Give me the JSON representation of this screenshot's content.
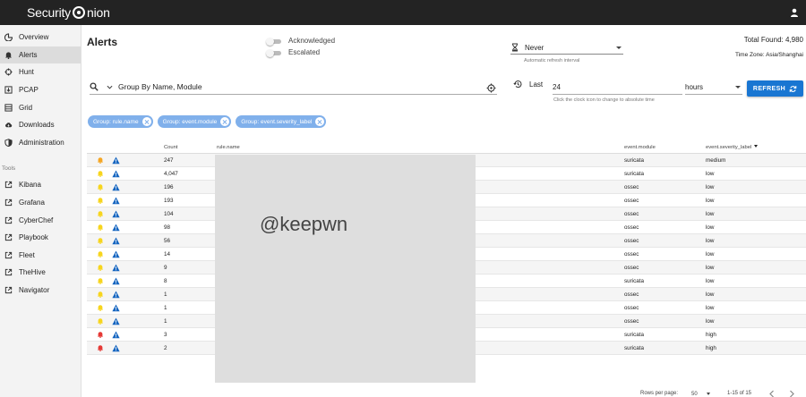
{
  "app": {
    "brand_prefix": "Security ",
    "brand_suffix": "nion"
  },
  "sidebar": {
    "items": [
      {
        "label": "Overview",
        "icon": "dashboard-icon"
      },
      {
        "label": "Alerts",
        "icon": "bell-icon",
        "active": true
      },
      {
        "label": "Hunt",
        "icon": "crosshair-icon"
      },
      {
        "label": "PCAP",
        "icon": "download-box-icon"
      },
      {
        "label": "Grid",
        "icon": "grid-icon"
      },
      {
        "label": "Downloads",
        "icon": "cloud-download-icon"
      },
      {
        "label": "Administration",
        "icon": "shield-icon"
      }
    ],
    "tools_label": "Tools",
    "tools": [
      {
        "label": "Kibana",
        "icon": "external-link-icon"
      },
      {
        "label": "Grafana",
        "icon": "external-link-icon"
      },
      {
        "label": "CyberChef",
        "icon": "external-link-icon"
      },
      {
        "label": "Playbook",
        "icon": "external-link-icon"
      },
      {
        "label": "Fleet",
        "icon": "external-link-icon"
      },
      {
        "label": "TheHive",
        "icon": "external-link-icon"
      },
      {
        "label": "Navigator",
        "icon": "external-link-icon"
      }
    ]
  },
  "header": {
    "title": "Alerts",
    "acknowledged_label": "Acknowledged",
    "escalated_label": "Escalated",
    "refresh_value": "Never",
    "refresh_hint": "Automatic refresh interval",
    "total_found": "Total Found: 4,980",
    "timezone": "Time Zone: Asia/Shanghai"
  },
  "query": {
    "group_by": "Group By Name, Module",
    "last_label": "Last",
    "last_value": "24",
    "unit": "hours",
    "time_hint": "Click the clock icon to change to absolute time",
    "refresh_button": "REFRESH"
  },
  "chips": [
    "Group: rule.name",
    "Group: event.module",
    "Group: event.severity_label"
  ],
  "table": {
    "headers": {
      "count": "Count",
      "rule": "rule.name",
      "module": "event.module",
      "severity": "event.severity_label"
    },
    "rows": [
      {
        "count": "247",
        "module": "suricata",
        "severity": "medium",
        "bell_color": "#f5a623"
      },
      {
        "count": "4,047",
        "module": "suricata",
        "severity": "low",
        "bell_color": "#f7d51d"
      },
      {
        "count": "196",
        "module": "ossec",
        "severity": "low",
        "bell_color": "#f7d51d"
      },
      {
        "count": "193",
        "module": "ossec",
        "severity": "low",
        "bell_color": "#f7d51d"
      },
      {
        "count": "104",
        "module": "ossec",
        "severity": "low",
        "bell_color": "#f7d51d"
      },
      {
        "count": "98",
        "module": "ossec",
        "severity": "low",
        "bell_color": "#f7d51d"
      },
      {
        "count": "56",
        "module": "ossec",
        "severity": "low",
        "bell_color": "#f7d51d"
      },
      {
        "count": "14",
        "module": "ossec",
        "severity": "low",
        "bell_color": "#f7d51d"
      },
      {
        "count": "9",
        "module": "ossec",
        "severity": "low",
        "bell_color": "#f7d51d"
      },
      {
        "count": "8",
        "module": "suricata",
        "severity": "low",
        "bell_color": "#f7d51d"
      },
      {
        "count": "1",
        "module": "ossec",
        "severity": "low",
        "bell_color": "#f7d51d"
      },
      {
        "count": "1",
        "module": "ossec",
        "severity": "low",
        "bell_color": "#f7d51d"
      },
      {
        "count": "1",
        "module": "ossec",
        "severity": "low",
        "bell_color": "#f7d51d"
      },
      {
        "count": "3",
        "module": "suricata",
        "severity": "high",
        "bell_color": "#e53935"
      },
      {
        "count": "2",
        "module": "suricata",
        "severity": "high",
        "bell_color": "#e53935"
      }
    ]
  },
  "watermark": "@keepwn",
  "footer": {
    "rows_per_page_label": "Rows per page:",
    "rows_per_page": "50",
    "range": "1-15 of 15"
  },
  "colors": {
    "accent": "#1976d2",
    "chip": "#80b0eb",
    "warn": "#1565c0"
  }
}
